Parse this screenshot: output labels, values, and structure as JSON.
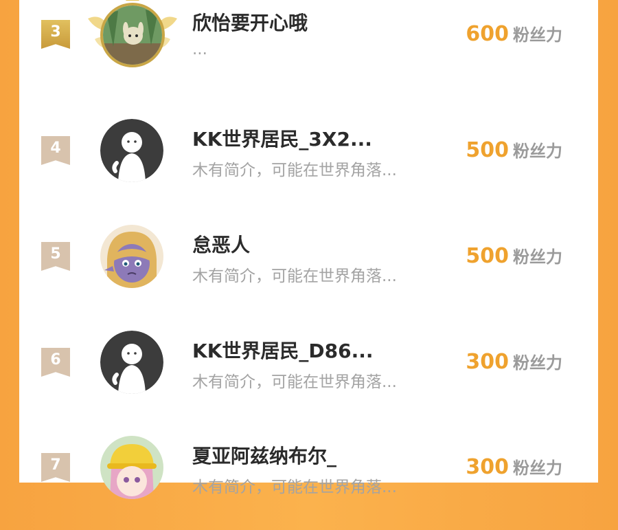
{
  "entries": [
    {
      "rank": "3",
      "name": "欣怡要开心哦",
      "bio": "...",
      "score": "600",
      "unit": "粉丝力",
      "avatar": "forest-character-avatar"
    },
    {
      "rank": "4",
      "name": "KK世界居民_3X2...",
      "bio": "木有简介，可能在世界角落...",
      "score": "500",
      "unit": "粉丝力",
      "avatar": "default-user-avatar"
    },
    {
      "rank": "5",
      "name": "怠恶人",
      "bio": "木有简介，可能在世界角落...",
      "score": "500",
      "unit": "粉丝力",
      "avatar": "anime-elf-avatar"
    },
    {
      "rank": "6",
      "name": "KK世界居民_D86...",
      "bio": "木有简介，可能在世界角落...",
      "score": "300",
      "unit": "粉丝力",
      "avatar": "default-user-avatar"
    },
    {
      "rank": "7",
      "name": "夏亚阿兹纳布尔_",
      "bio": "木有简介，可能在世界角落...",
      "score": "300",
      "unit": "粉丝力",
      "avatar": "anime-girl-yellow-hat-avatar"
    }
  ],
  "colors": {
    "accent": "#efa22e",
    "rank_gold": "#d4ad4c",
    "rank_default": "#d8c3ad",
    "frame": "#f7a340"
  }
}
